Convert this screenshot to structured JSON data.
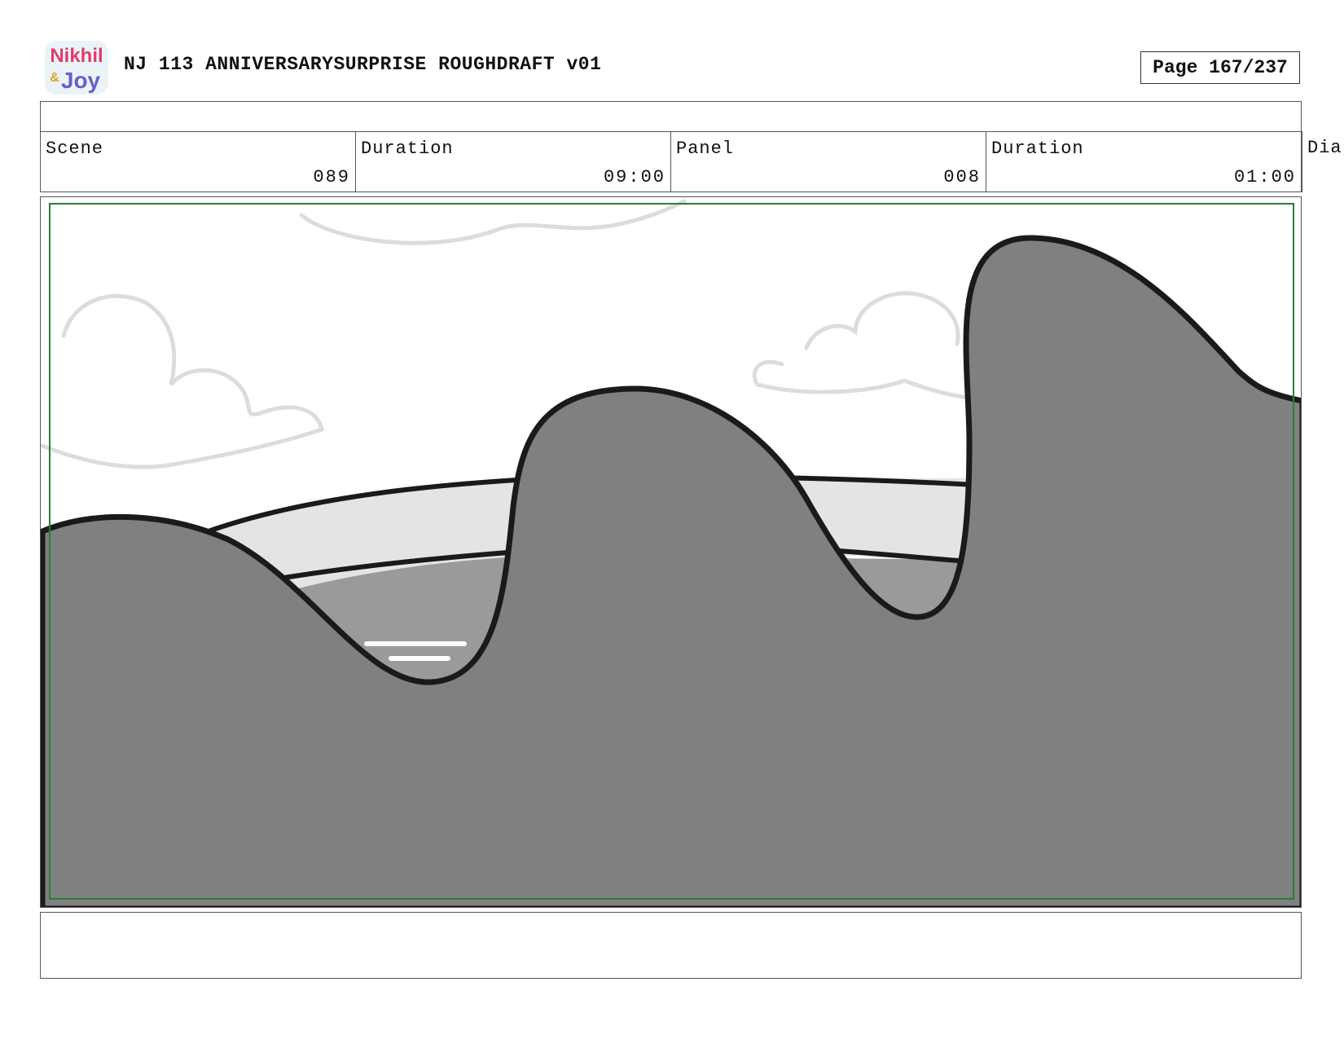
{
  "header": {
    "logo_text_top": "Nikhil",
    "logo_text_amp": "&",
    "logo_text_bottom": "Joy",
    "title": "NJ 113 ANNIVERSARYSURPRISE ROUGHDRAFT v01",
    "page_label": "Page 167/237"
  },
  "info": {
    "scene_label": "Scene",
    "scene_value": "089",
    "duration_label": "Duration",
    "duration_value": "09:00",
    "panel_label": "Panel",
    "panel_value": "008",
    "panel_duration_label": "Duration",
    "panel_duration_value": "01:00",
    "dialogue_label": "Dia"
  },
  "colors": {
    "hill_fill": "#808080",
    "pond_fill": "#9a9a9a",
    "rim_fill": "#e4e4e4",
    "cloud_stroke": "#dcdcdc",
    "safe_frame": "#2e7d32",
    "outline": "#1a1a1a"
  }
}
